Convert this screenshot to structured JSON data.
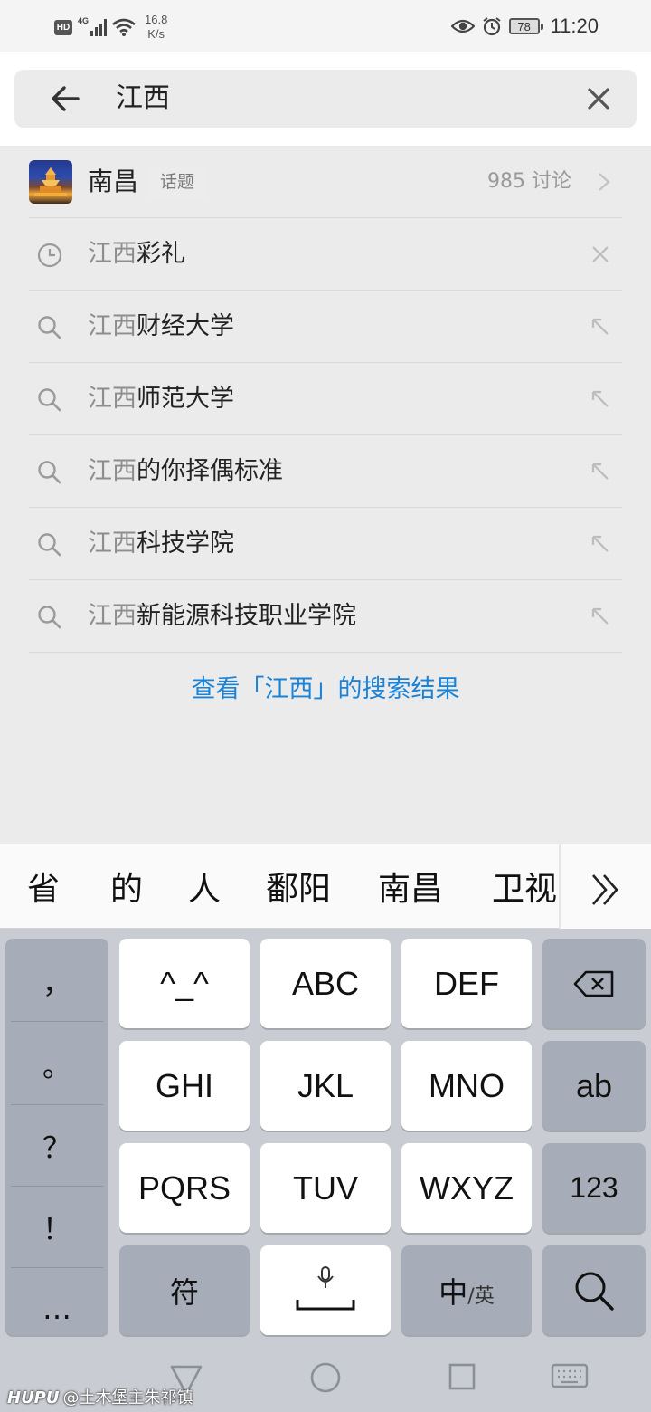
{
  "status_bar": {
    "hd": "HD",
    "network": "4G",
    "speed_value": "16.8",
    "speed_unit": "K/s",
    "battery": "78",
    "time": "11:20"
  },
  "search": {
    "query": "江西"
  },
  "topic": {
    "name": "南昌",
    "tag": "话题",
    "count": "985 讨论"
  },
  "suggestions": [
    {
      "type": "history",
      "highlight": "江西",
      "rest": "彩礼"
    },
    {
      "type": "search",
      "highlight": "江西",
      "rest": "财经大学"
    },
    {
      "type": "search",
      "highlight": "江西",
      "rest": "师范大学"
    },
    {
      "type": "search",
      "highlight": "江西",
      "rest": "的你择偶标准"
    },
    {
      "type": "search",
      "highlight": "江西",
      "rest": "科技学院"
    },
    {
      "type": "search",
      "highlight": "江西",
      "rest": "新能源科技职业学院"
    }
  ],
  "see_results": "查看「江西」的搜索结果",
  "candidates": [
    "省",
    "的",
    "人",
    "鄱阳",
    "南昌",
    "卫视"
  ],
  "keyboard": {
    "punct": [
      "，",
      "。",
      "？",
      "！",
      "…"
    ],
    "keys": {
      "emoticon": "^_^",
      "abc": "ABC",
      "def": "DEF",
      "ghi": "GHI",
      "jkl": "JKL",
      "mno": "MNO",
      "ab": "ab",
      "pqrs": "PQRS",
      "tuv": "TUV",
      "wxyz": "WXYZ",
      "num": "123",
      "symbol": "符",
      "lang_zh": "中",
      "lang_sep": "/",
      "lang_en": "英"
    }
  },
  "watermark": {
    "brand": "HUPU",
    "user": "@土木堡主朱祁镇"
  },
  "colors": {
    "link_blue": "#1a83d8",
    "highlight_gray": "#8d8d8d",
    "keyboard_bg": "#c9ccd2"
  }
}
